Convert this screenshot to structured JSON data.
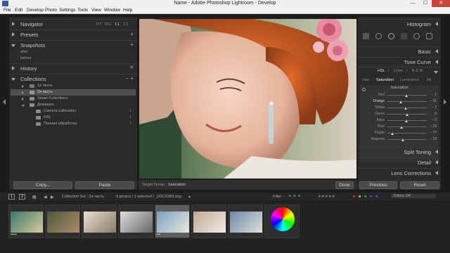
{
  "window": {
    "title": "Name - Adobe Photoshop Lightroom - Develop",
    "minimize": "—",
    "maximize": "☐",
    "close": "✕"
  },
  "menu": [
    "File",
    "Edit",
    "Develop",
    "Photo",
    "Settings",
    "Tools",
    "View",
    "Window",
    "Help"
  ],
  "left_panel": {
    "navigator": {
      "label": "Navigator",
      "zoom": [
        "FIT",
        "FILL",
        "1:1",
        "1:3"
      ]
    },
    "presets": {
      "label": "Presets"
    },
    "snapshots": {
      "label": "Snapshots",
      "items": [
        "after",
        "before"
      ]
    },
    "history": {
      "label": "History"
    },
    "collections": {
      "label": "Collections",
      "rows": [
        {
          "label": "1я часть",
          "count": ""
        },
        {
          "label": "2я часть",
          "count": ""
        },
        {
          "label": "Smart Collections",
          "count": ""
        },
        {
          "label": "Домашка",
          "count": ""
        },
        {
          "label": "Camera calibration",
          "count": "1"
        },
        {
          "label": "HSL",
          "count": "1"
        },
        {
          "label": "Полная обработка",
          "count": "1"
        }
      ]
    },
    "copy_button": "Copy...",
    "paste_button": "Paste"
  },
  "center": {
    "target_group_label": "Target Group :",
    "target_group_value": "Saturation",
    "done_button": "Done"
  },
  "right_panel": {
    "histogram": "Histogram",
    "basic": "Basic",
    "tone_curve": "Tone Curve",
    "hsl_tabs": [
      "HSL",
      "/",
      "Color",
      "/",
      "B & W"
    ],
    "sub_tabs": [
      "Hue",
      "Saturation",
      "Luminance",
      "All"
    ],
    "section": "Saturation",
    "sliders": [
      {
        "name": "Red",
        "value": "− 1",
        "pos": 0.49
      },
      {
        "name": "Orange",
        "value": "− 31",
        "pos": 0.34
      },
      {
        "name": "Yellow",
        "value": "− 7",
        "pos": 0.46
      },
      {
        "name": "Green",
        "value": "0",
        "pos": 0.5
      },
      {
        "name": "Aqua",
        "value": "− 3",
        "pos": 0.48
      },
      {
        "name": "Blue",
        "value": "− 29",
        "pos": 0.35
      },
      {
        "name": "Purple",
        "value": "− 77",
        "pos": 0.12
      },
      {
        "name": "Magenta",
        "value": "− 19",
        "pos": 0.4
      }
    ],
    "split_toning": "Split Toning",
    "detail": "Detail",
    "lens_corrections": "Lens Corrections",
    "previous_button": "Previous",
    "reset_button": "Reset"
  },
  "filmstrip": {
    "views": [
      "1",
      "2"
    ],
    "collection_set": "Collection Set : 2я часть",
    "info": "8 photos / 1 selected / _DSC0383.dng",
    "filter_label": "Filter :",
    "filters_off": "Filters Off",
    "thumb_stars": [
      "•••••",
      "",
      "",
      "",
      "•••",
      "",
      "",
      ""
    ]
  },
  "colors": {
    "accent": "#c75b2a",
    "panel": "#2a2a2a",
    "highlight": "#5e5e5e"
  }
}
